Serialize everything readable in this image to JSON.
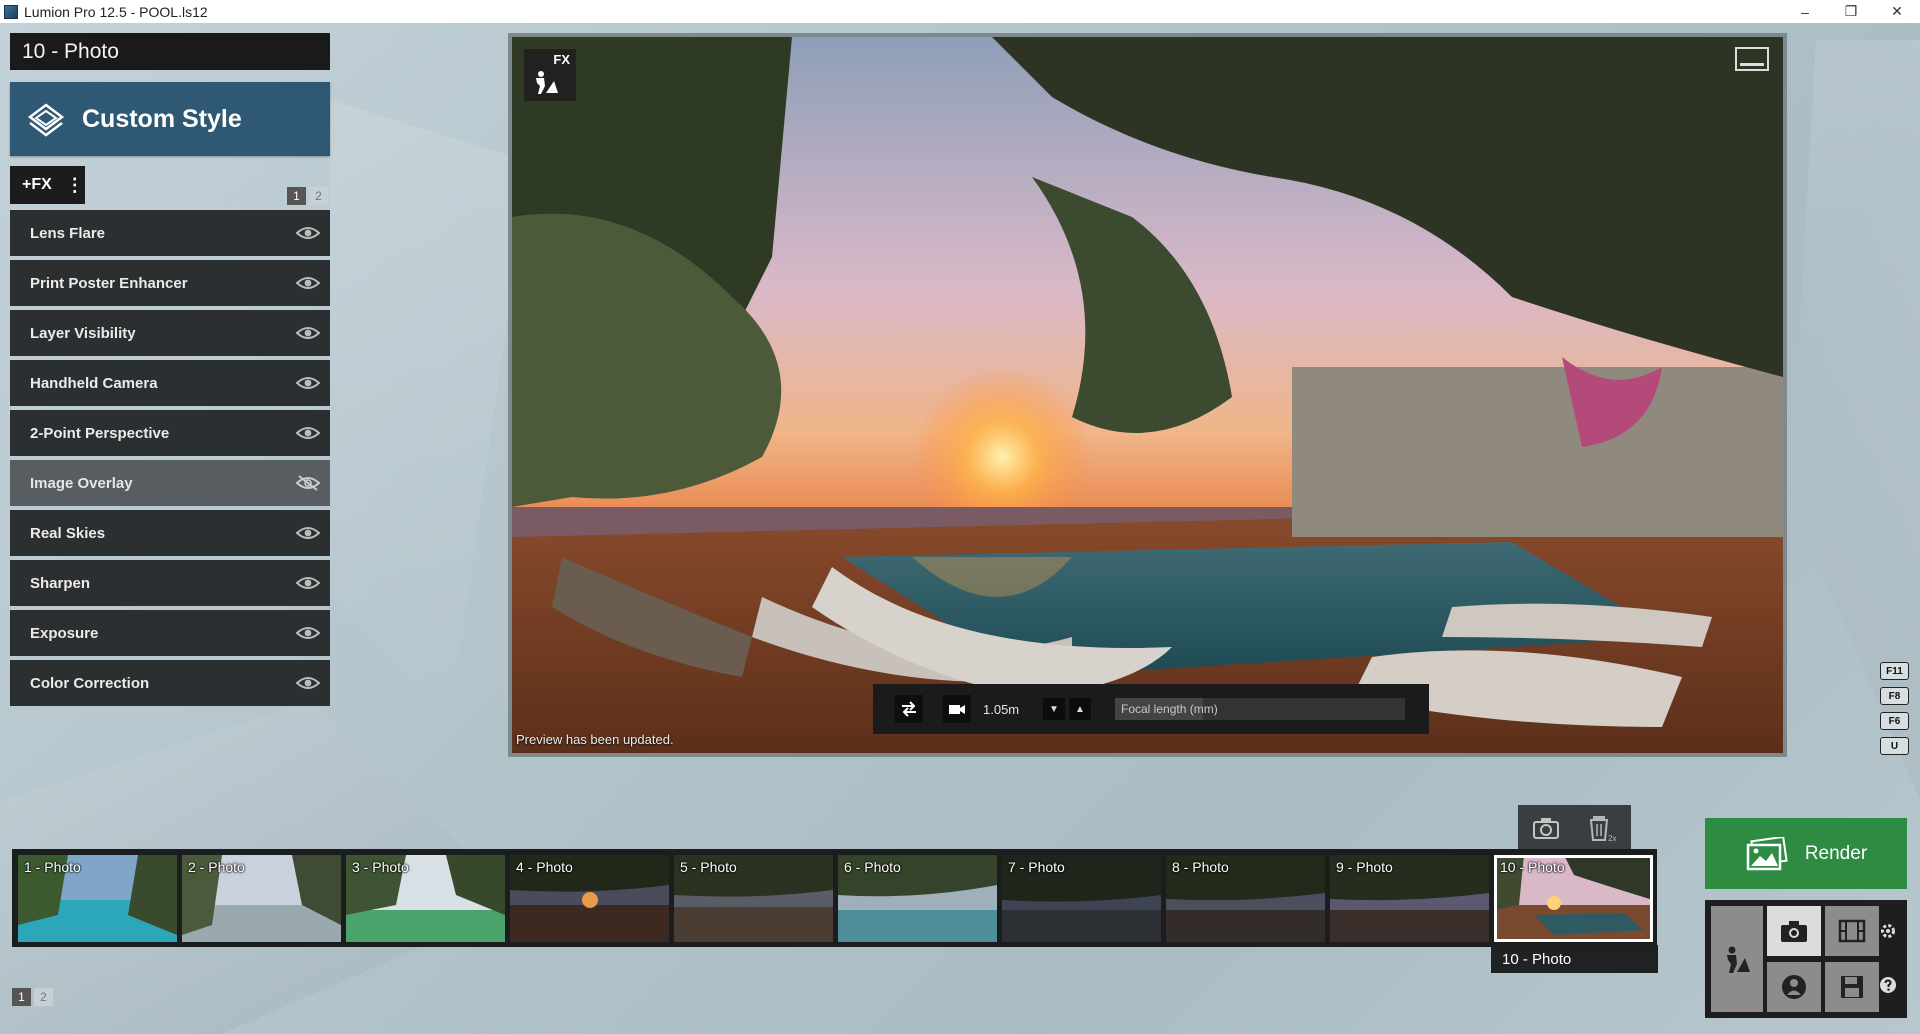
{
  "window": {
    "title": "Lumion Pro 12.5 - POOL.ls12",
    "controls": {
      "minimize": "–",
      "restore": "❐",
      "close": "✕"
    }
  },
  "left_panel": {
    "scene_title": "10 - Photo",
    "style_button": "Custom Style",
    "add_fx_label": "+FX",
    "add_fx_menu": "⋮",
    "pages": [
      "1",
      "2"
    ],
    "effects": [
      {
        "label": "Lens Flare",
        "visible": true
      },
      {
        "label": "Print Poster Enhancer",
        "visible": true
      },
      {
        "label": "Layer Visibility",
        "visible": true
      },
      {
        "label": "Handheld Camera",
        "visible": true
      },
      {
        "label": "2-Point Perspective",
        "visible": true
      },
      {
        "label": "Image Overlay",
        "visible": false
      },
      {
        "label": "Real Skies",
        "visible": true
      },
      {
        "label": "Sharpen",
        "visible": true
      },
      {
        "label": "Exposure",
        "visible": true
      },
      {
        "label": "Color Correction",
        "visible": true
      }
    ]
  },
  "viewport": {
    "fx_badge": "FX",
    "status": "Preview has been updated.",
    "camera_bar": {
      "height_value": "1.05m",
      "focal_placeholder": "Focal length (mm)",
      "down_arrow": "▼",
      "up_arrow": "▲"
    }
  },
  "hotkeys": [
    "F11",
    "F8",
    "F6",
    "U"
  ],
  "filmstrip": {
    "thumbnails": [
      "1 - Photo",
      "2 - Photo",
      "3 - Photo",
      "4 - Photo",
      "5 - Photo",
      "6 - Photo",
      "7 - Photo",
      "8 - Photo",
      "9 - Photo",
      "10 - Photo"
    ],
    "selected_label": "10 - Photo",
    "pages": [
      "1",
      "2"
    ],
    "delete_label": "2x"
  },
  "render": {
    "label": "Render"
  },
  "colors": {
    "style_accent": "#2e5873",
    "render_green": "#2e8b42",
    "panel_dark": "#2b2f31"
  }
}
